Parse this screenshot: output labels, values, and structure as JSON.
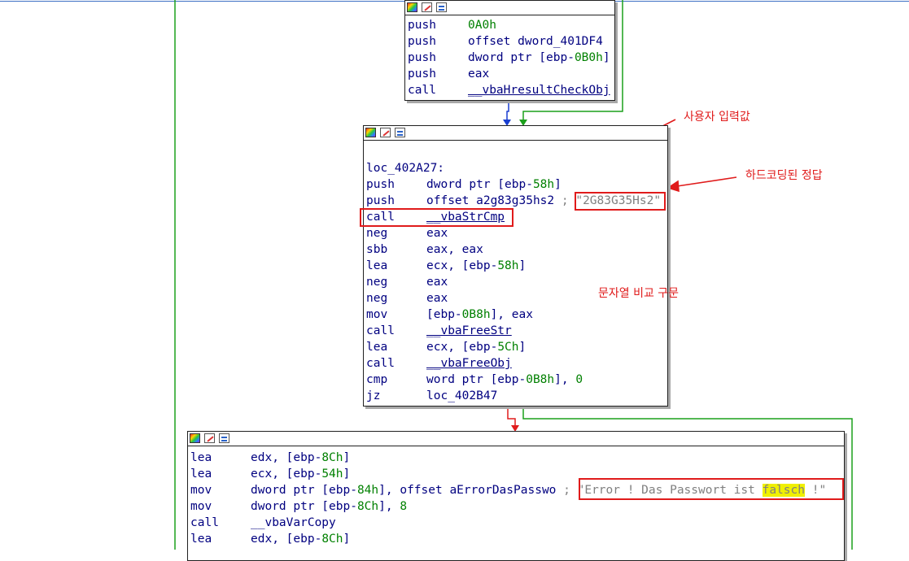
{
  "block1": {
    "lines": [
      {
        "mn": "push",
        "ops": [
          {
            "t": "0A0h",
            "c": "num"
          }
        ]
      },
      {
        "mn": "push",
        "ops": [
          {
            "t": "offset dword_401DF4"
          }
        ]
      },
      {
        "mn": "push",
        "ops": [
          {
            "t": "dword ptr [ebp-"
          },
          {
            "t": "0B0h",
            "c": "num"
          },
          {
            "t": "]"
          }
        ]
      },
      {
        "mn": "push",
        "ops": [
          {
            "t": "eax"
          }
        ]
      },
      {
        "mn": "call",
        "ops": [
          {
            "t": "__vbaHresultCheckObj",
            "c": "fn"
          }
        ]
      }
    ]
  },
  "block2": {
    "label": "loc_402A27:",
    "lines": [
      {
        "mn": "push",
        "ops": [
          {
            "t": "dword ptr [ebp-"
          },
          {
            "t": "58h",
            "c": "num"
          },
          {
            "t": "]"
          }
        ]
      },
      {
        "mn": "push",
        "ops": [
          {
            "t": "offset a2g83g35hs2 "
          },
          {
            "t": "; ",
            "c": "cmt"
          },
          {
            "t": "\"2G83G35Hs2\"",
            "c": "cmt"
          }
        ]
      },
      {
        "mn": "call",
        "ops": [
          {
            "t": "__vbaStrCmp",
            "c": "fn"
          }
        ]
      },
      {
        "mn": "neg",
        "ops": [
          {
            "t": "eax"
          }
        ]
      },
      {
        "mn": "sbb",
        "ops": [
          {
            "t": "eax, eax"
          }
        ]
      },
      {
        "mn": "lea",
        "ops": [
          {
            "t": "ecx, [ebp-"
          },
          {
            "t": "58h",
            "c": "num"
          },
          {
            "t": "]"
          }
        ]
      },
      {
        "mn": "neg",
        "ops": [
          {
            "t": "eax"
          }
        ]
      },
      {
        "mn": "neg",
        "ops": [
          {
            "t": "eax"
          }
        ]
      },
      {
        "mn": "mov",
        "ops": [
          {
            "t": "[ebp-"
          },
          {
            "t": "0B8h",
            "c": "num"
          },
          {
            "t": "], eax"
          }
        ]
      },
      {
        "mn": "call",
        "ops": [
          {
            "t": "__vbaFreeStr",
            "c": "fn"
          }
        ]
      },
      {
        "mn": "lea",
        "ops": [
          {
            "t": "ecx, [ebp-"
          },
          {
            "t": "5Ch",
            "c": "num"
          },
          {
            "t": "]"
          }
        ]
      },
      {
        "mn": "call",
        "ops": [
          {
            "t": "__vbaFreeObj",
            "c": "fn"
          }
        ]
      },
      {
        "mn": "cmp",
        "ops": [
          {
            "t": "word ptr [ebp-"
          },
          {
            "t": "0B8h",
            "c": "num"
          },
          {
            "t": "], "
          },
          {
            "t": "0",
            "c": "num"
          }
        ]
      },
      {
        "mn": "jz",
        "ops": [
          {
            "t": "loc_402B47"
          }
        ]
      }
    ]
  },
  "block3": {
    "lines": [
      {
        "mn": "lea",
        "ops": [
          {
            "t": "edx, [ebp-"
          },
          {
            "t": "8Ch",
            "c": "num"
          },
          {
            "t": "]"
          }
        ]
      },
      {
        "mn": "lea",
        "ops": [
          {
            "t": "ecx, [ebp-"
          },
          {
            "t": "54h",
            "c": "num"
          },
          {
            "t": "]"
          }
        ]
      },
      {
        "mn": "mov",
        "ops": [
          {
            "t": "dword ptr [ebp-"
          },
          {
            "t": "84h",
            "c": "num"
          },
          {
            "t": "], offset aErrorDasPasswo "
          },
          {
            "t": "; ",
            "c": "cmt"
          },
          {
            "t": "\"Error ! Das Passwort ist ",
            "c": "cmt"
          },
          {
            "t": "falsch",
            "c": "cmt hl"
          },
          {
            "t": " !\"",
            "c": "cmt"
          }
        ]
      },
      {
        "mn": "mov",
        "ops": [
          {
            "t": "dword ptr [ebp-"
          },
          {
            "t": "8Ch",
            "c": "num"
          },
          {
            "t": "], "
          },
          {
            "t": "8",
            "c": "num"
          }
        ]
      },
      {
        "mn": "call",
        "ops": [
          {
            "t": "__vbaVarCopy"
          }
        ]
      },
      {
        "mn": "lea",
        "ops": [
          {
            "t": "edx, [ebp-"
          },
          {
            "t": "8Ch",
            "c": "num"
          },
          {
            "t": "]"
          }
        ]
      }
    ]
  },
  "annotations": {
    "user_input": "사용자 입력값",
    "hardcoded": "하드코딩된 정답",
    "compare": "문자열 비교 구문"
  },
  "colors": {
    "edge_true": "#1ca01c",
    "edge_false": "#e01b1b",
    "edge_flow": "#1a3fd0",
    "annotation": "#e01b1b",
    "code_text": "#000080",
    "immediate": "#008000",
    "comment": "#808080",
    "highlight": "#f0f000"
  },
  "icons": [
    "color-palette-icon",
    "edit-node-icon",
    "graph-overview-icon"
  ]
}
